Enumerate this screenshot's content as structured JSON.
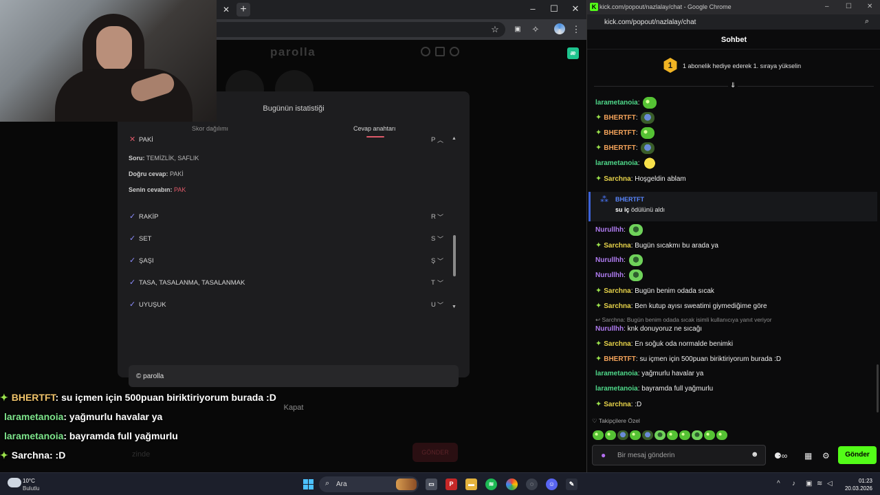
{
  "left_browser": {
    "toolbar_icons": [
      "star-icon",
      "translate-icon",
      "extensions-icon",
      "menu-icon"
    ],
    "window_controls": [
      "–",
      "☐",
      "✕"
    ]
  },
  "game": {
    "brand": "parolla",
    "modal": {
      "title": "Bugünün istatistiği",
      "tabs": [
        "Skor dağılımı",
        "Cevap anahtarı"
      ],
      "expanded": {
        "word": "PAKİ",
        "letter": "P",
        "question_label": "Soru:",
        "question": "TEMİZLİK, SAFLIK",
        "correct_label": "Doğru cevap:",
        "correct": "PAKİ",
        "yours_label": "Senin cevabın:",
        "yours": "PAK"
      },
      "answers": [
        {
          "word": "RAKİP",
          "letter": "R"
        },
        {
          "word": "SET",
          "letter": "S"
        },
        {
          "word": "ŞAŞI",
          "letter": "Ş"
        },
        {
          "word": "TASA, TASALANMA, TASALANMAK",
          "letter": "T"
        },
        {
          "word": "UYUŞUK",
          "letter": "U"
        }
      ],
      "share_text": "© parolla",
      "close_label": "Kapat"
    },
    "bottom_hint": "zinde",
    "bottom_button": "GÖNDER"
  },
  "overlay_chat": [
    {
      "user": "BHERTFT",
      "text": ": su içmen için 500puan biriktiriyorum burada :D",
      "badge": true
    },
    {
      "user": "larametanoia",
      "text": ": yağmurlu havalar ya",
      "badge": false
    },
    {
      "user": "larametanoia",
      "text": ": bayramda full yağmurlu",
      "badge": false
    },
    {
      "user": "Sarchna",
      "text": ": :D",
      "badge": true
    }
  ],
  "chat_window": {
    "title": "kick.com/popout/nazlalay/chat - Google Chrome",
    "url": "kick.com/popout/nazlalay/chat",
    "header": "Sohbet",
    "pinned_rank": "1",
    "pinned_text": "1 abonelik hediye ederek 1. sıraya yükselin",
    "messages": [
      {
        "user": "larametanoia",
        "text": "",
        "emote": "frog"
      },
      {
        "user": "BHERTFT",
        "text": "",
        "emote": "ball"
      },
      {
        "user": "BHERTFT",
        "text": "",
        "emote": "frog"
      },
      {
        "user": "BHERTFT",
        "text": "",
        "emote": "ball"
      },
      {
        "user": "larametanoia",
        "text": "",
        "emote": "pac"
      },
      {
        "user": "Sarchna",
        "text": "Hoşgeldin ablam",
        "emote": ""
      }
    ],
    "reward": {
      "user": "BHERTFT",
      "item": "su iç",
      "suffix": " ödülünü aldı"
    },
    "messages2": [
      {
        "user": "Nurullhh",
        "text": "",
        "emote": "gfrog"
      },
      {
        "user": "Sarchna",
        "text": "Bugün sıcakmı bu arada ya",
        "emote": ""
      },
      {
        "user": "Nurullhh",
        "text": "",
        "emote": "gfrog"
      },
      {
        "user": "Nurullhh",
        "text": "",
        "emote": "gfrog"
      },
      {
        "user": "Sarchna",
        "text": "Bugün benim odada sıcak",
        "emote": ""
      },
      {
        "user": "Sarchna",
        "text": "Ben kutup ayısı sweatimi giymediğime göre",
        "emote": ""
      }
    ],
    "reply_note": "↩ Sarchna: Bugün benim odada sıcak isimli kullanıcıya yanıt veriyor",
    "messages3": [
      {
        "user": "Nurullhh",
        "text": "knk donuyoruz ne sıcağı"
      },
      {
        "user": "Sarchna",
        "text": "En soğuk oda normalde benimki"
      },
      {
        "user": "BHERTFT",
        "text": "su içmen için 500puan biriktiriyorum burada :D"
      },
      {
        "user": "larametanoia",
        "text": "yağmurlu havalar ya"
      },
      {
        "user": "larametanoia",
        "text": "bayramda full yağmurlu"
      },
      {
        "user": "Sarchna",
        "text": ":D"
      }
    ],
    "follow_label": "♡ Takipçilere Özel",
    "input_placeholder": "Bir mesaj gönderin",
    "send_label": "Gönder"
  },
  "taskbar": {
    "temp": "10°C",
    "weather": "Bulutlu",
    "search_label": "Ara",
    "time": "01:23",
    "date": "20.03.2026"
  }
}
